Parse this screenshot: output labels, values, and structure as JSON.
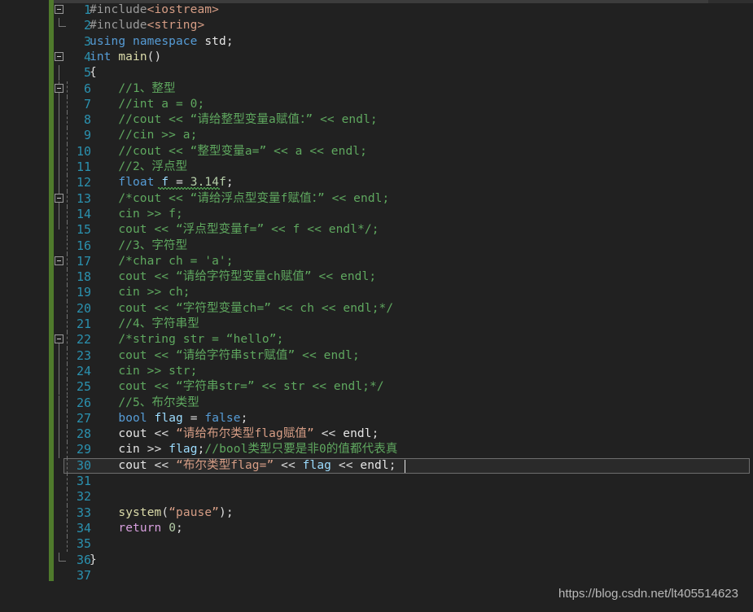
{
  "editor": {
    "theme": "visual-studio-dark",
    "language": "C++",
    "background_color": "#212121",
    "line_number_color": "#2b91af",
    "change_bar_color": "#4f7a2c",
    "current_line": 30,
    "total_lines": 37,
    "first_visible_line": 1
  },
  "watermark": {
    "text": "https://blog.csdn.net/lt405514623"
  },
  "colors": {
    "keyword": "#569cd6",
    "string": "#d69d85",
    "comment": "#5fa85f",
    "preprocessor": "#9b9b9b",
    "identifier": "#9cdcfe",
    "function": "#dcdcaa",
    "control": "#d8a0df",
    "number": "#b5cea8",
    "plain": "#dcdcdc"
  },
  "lines": [
    {
      "n": 1,
      "text": "#include<iostream>"
    },
    {
      "n": 2,
      "text": "#include<string>"
    },
    {
      "n": 3,
      "text": "using namespace std;"
    },
    {
      "n": 4,
      "text": "int main()"
    },
    {
      "n": 5,
      "text": "{"
    },
    {
      "n": 6,
      "text": "    //1、整型"
    },
    {
      "n": 7,
      "text": "    //int a = 0;"
    },
    {
      "n": 8,
      "text": "    //cout << “请给整型变量a赋值：” << endl;"
    },
    {
      "n": 9,
      "text": "    //cin >> a;"
    },
    {
      "n": 10,
      "text": "    //cout << “整型变量a=” << a << endl;"
    },
    {
      "n": 11,
      "text": "    //2、浮点型"
    },
    {
      "n": 12,
      "text": "    float f = 3.14f;"
    },
    {
      "n": 13,
      "text": "    /*cout << “请给浮点型变量f赋值：” << endl;"
    },
    {
      "n": 14,
      "text": "    cin >> f;"
    },
    {
      "n": 15,
      "text": "    cout << “浮点型变量f=” << f << endl*/;"
    },
    {
      "n": 16,
      "text": "    //3、字符型"
    },
    {
      "n": 17,
      "text": "    /*char ch = 'a';"
    },
    {
      "n": 18,
      "text": "    cout << “请给字符型变量ch赋值” << endl;"
    },
    {
      "n": 19,
      "text": "    cin >> ch;"
    },
    {
      "n": 20,
      "text": "    cout << “字符型变量ch=” << ch << endl;*/"
    },
    {
      "n": 21,
      "text": "    //4、字符串型"
    },
    {
      "n": 22,
      "text": "    /*string str = “hello”;"
    },
    {
      "n": 23,
      "text": "    cout << “请给字符串str赋值” << endl;"
    },
    {
      "n": 24,
      "text": "    cin >> str;"
    },
    {
      "n": 25,
      "text": "    cout << “字符串str=” << str << endl;*/"
    },
    {
      "n": 26,
      "text": "    //5、布尔类型"
    },
    {
      "n": 27,
      "text": "    bool flag = false;"
    },
    {
      "n": 28,
      "text": "    cout << “请给布尔类型flag赋值” << endl;"
    },
    {
      "n": 29,
      "text": "    cin >> flag;//bool类型只要是非0的值都代表真"
    },
    {
      "n": 30,
      "text": "    cout << “布尔类型flag=” << flag << endl;"
    },
    {
      "n": 31,
      "text": ""
    },
    {
      "n": 32,
      "text": ""
    },
    {
      "n": 33,
      "text": "    system(“pause”);"
    },
    {
      "n": 34,
      "text": "    return 0;"
    },
    {
      "n": 35,
      "text": ""
    },
    {
      "n": 36,
      "text": "}"
    },
    {
      "n": 37,
      "text": ""
    }
  ],
  "fold_markers": [
    {
      "line": 1,
      "state": "expanded"
    },
    {
      "line": 4,
      "state": "expanded"
    },
    {
      "line": 6,
      "state": "expanded"
    },
    {
      "line": 13,
      "state": "expanded"
    },
    {
      "line": 17,
      "state": "expanded"
    },
    {
      "line": 22,
      "state": "expanded"
    }
  ],
  "diagnostics": [
    {
      "line": 12,
      "kind": "squiggle",
      "span": "f = 3.14f",
      "color": "#4f9e4f"
    }
  ]
}
